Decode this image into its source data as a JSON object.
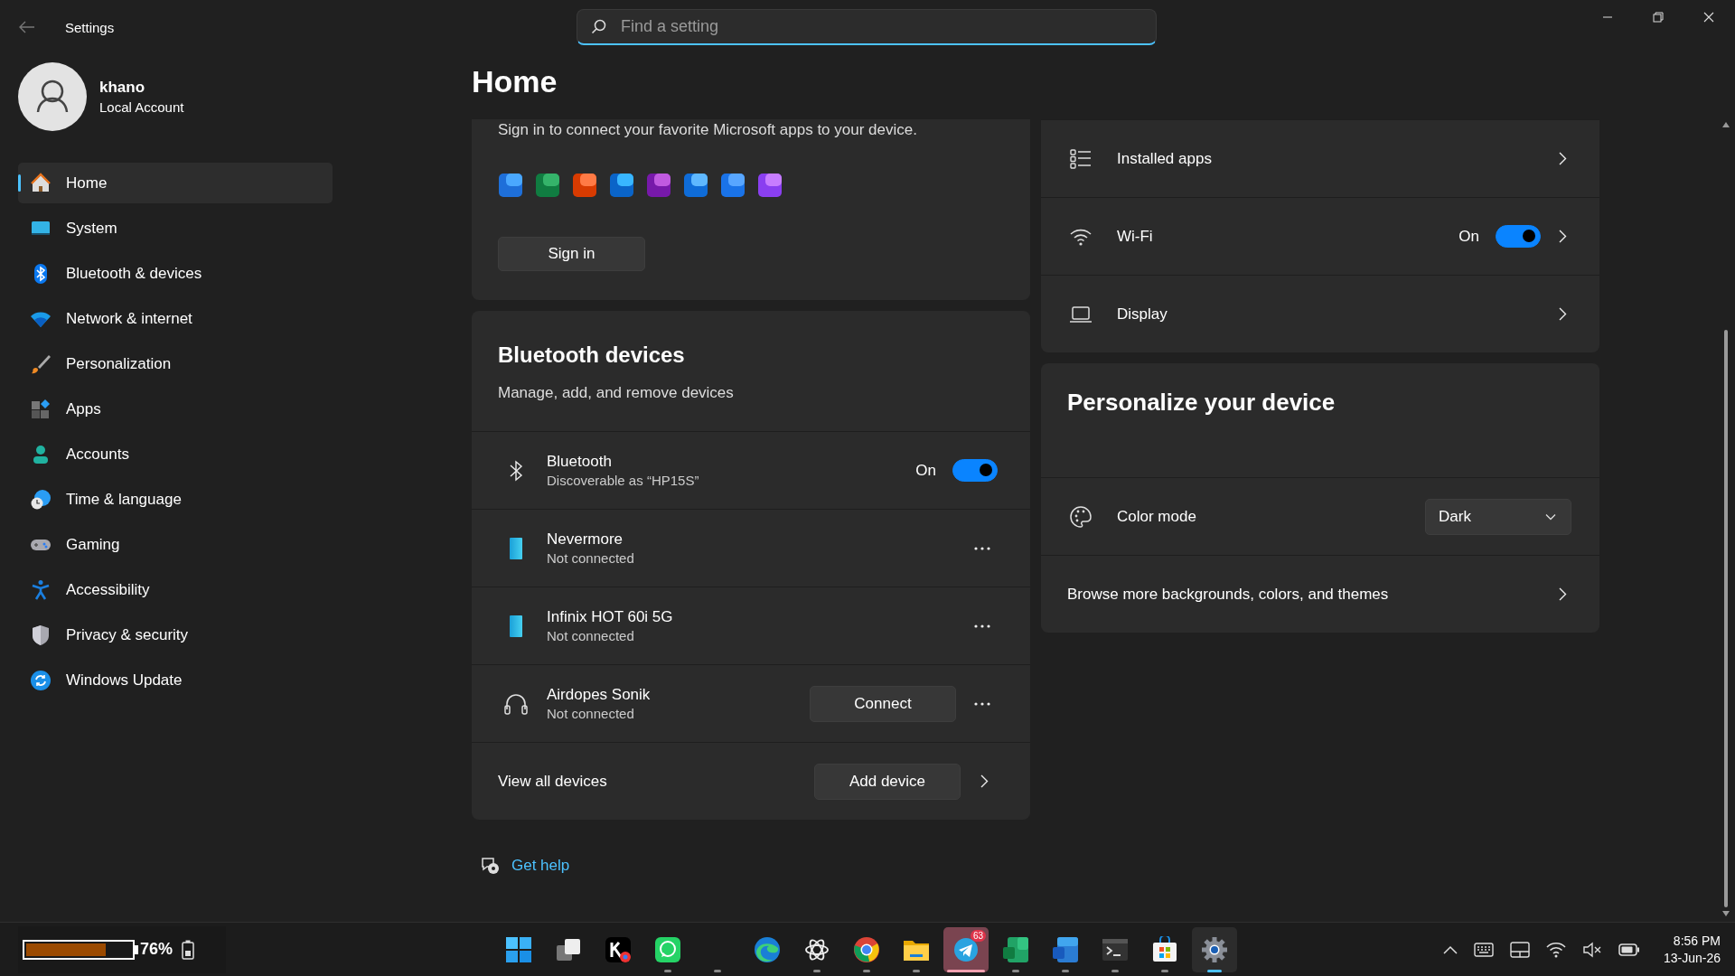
{
  "window": {
    "title": "Settings"
  },
  "search": {
    "placeholder": "Find a setting"
  },
  "account": {
    "name": "khano",
    "type": "Local Account"
  },
  "sidebar": {
    "items": [
      {
        "label": "Home",
        "selected": true
      },
      {
        "label": "System",
        "selected": false
      },
      {
        "label": "Bluetooth & devices",
        "selected": false
      },
      {
        "label": "Network & internet",
        "selected": false
      },
      {
        "label": "Personalization",
        "selected": false
      },
      {
        "label": "Apps",
        "selected": false
      },
      {
        "label": "Accounts",
        "selected": false
      },
      {
        "label": "Time & language",
        "selected": false
      },
      {
        "label": "Gaming",
        "selected": false
      },
      {
        "label": "Accessibility",
        "selected": false
      },
      {
        "label": "Privacy & security",
        "selected": false
      },
      {
        "label": "Windows Update",
        "selected": false
      }
    ]
  },
  "page_title": "Home",
  "sign_in_card": {
    "text": "Sign in to connect your favorite Microsoft apps to your device.",
    "button": "Sign in"
  },
  "bluetooth_card": {
    "title": "Bluetooth devices",
    "subtitle": "Manage, add, and remove devices",
    "bluetooth": {
      "label": "Bluetooth",
      "detail": "Discoverable as “HP15S”",
      "state_label": "On",
      "on": true
    },
    "devices": [
      {
        "kind": "phone",
        "name": "Nevermore",
        "status": "Not connected"
      },
      {
        "kind": "phone",
        "name": "Infinix HOT 60i 5G",
        "status": "Not connected"
      },
      {
        "kind": "headphones",
        "name": "Airdopes Sonik",
        "status": "Not connected",
        "action": "Connect"
      }
    ],
    "footer": {
      "label": "View all devices",
      "button": "Add device"
    }
  },
  "quick_settings": [
    {
      "kind": "link",
      "label": "Installed apps"
    },
    {
      "kind": "toggle",
      "label": "Wi-Fi",
      "state_label": "On",
      "on": true
    },
    {
      "kind": "link",
      "label": "Display"
    }
  ],
  "personalize_card": {
    "title": "Personalize your device",
    "color_mode": {
      "label": "Color mode",
      "value": "Dark"
    },
    "browse": "Browse more backgrounds, colors, and themes"
  },
  "help_link": "Get help",
  "taskbar": {
    "battery_widget": {
      "level": 0.76,
      "reading": "76%"
    },
    "apps": [
      {
        "kind": "start",
        "running": false,
        "selected": false,
        "attention": false
      },
      {
        "kind": "taskview",
        "running": false,
        "selected": false,
        "attention": false
      },
      {
        "kind": "kapp",
        "running": false,
        "selected": false,
        "attention": false
      },
      {
        "kind": "whatsapp",
        "running": true,
        "selected": false,
        "attention": false
      },
      {
        "kind": "blank",
        "running": true,
        "selected": false,
        "attention": false
      },
      {
        "kind": "edge",
        "running": false,
        "selected": false,
        "attention": false
      },
      {
        "kind": "chatgpt",
        "running": true,
        "selected": false,
        "attention": false
      },
      {
        "kind": "chrome",
        "running": true,
        "selected": false,
        "attention": false
      },
      {
        "kind": "files",
        "running": true,
        "selected": false,
        "attention": false
      },
      {
        "kind": "telegram",
        "running": true,
        "selected": false,
        "attention": true,
        "badge": "63"
      },
      {
        "kind": "excel",
        "running": true,
        "selected": false,
        "attention": false
      },
      {
        "kind": "word",
        "running": true,
        "selected": false,
        "attention": false
      },
      {
        "kind": "terminal",
        "running": true,
        "selected": false,
        "attention": false
      },
      {
        "kind": "store",
        "running": true,
        "selected": false,
        "attention": false
      },
      {
        "kind": "settings",
        "running": true,
        "selected": true,
        "attention": false
      }
    ],
    "clock": {
      "time": "8:56 PM",
      "date": "13-Jun-26"
    }
  }
}
